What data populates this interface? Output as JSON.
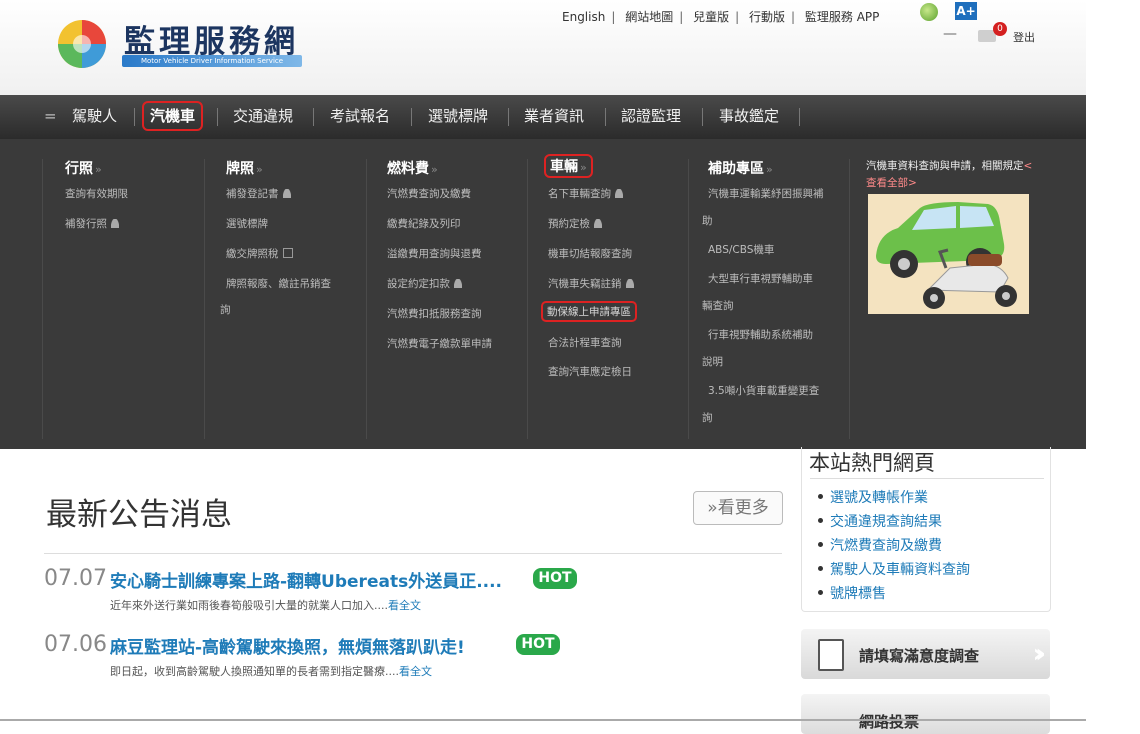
{
  "header": {
    "logo_title": "監理服務網",
    "logo_subtitle": "Motor Vehicle Driver Information Service",
    "top_links": [
      "English",
      "網站地圖",
      "兒童版",
      "行動版",
      "監理服務 APP"
    ],
    "accessible_label": "A+",
    "mail_count": "0",
    "logout": "登出"
  },
  "nav": {
    "items": [
      "駕駛人",
      "汽機車",
      "交通違規",
      "考試報名",
      "選號標牌",
      "業者資訊",
      "認證監理",
      "事故鑑定"
    ],
    "active": "汽機車"
  },
  "menu": {
    "col1": {
      "title": "行照",
      "items": [
        "查詢有效期限",
        "補發行照"
      ]
    },
    "col2": {
      "title": "牌照",
      "items": [
        "補發登記書",
        "選號標牌",
        "繳交牌照稅",
        "牌照報廢、繳註吊銷查",
        "詢"
      ]
    },
    "col3": {
      "title": "燃料費",
      "items": [
        "汽燃費查詢及繳費",
        "繳費紀錄及列印",
        "溢繳費用查詢與退費",
        "設定約定扣款",
        "汽燃費扣抵服務查詢",
        "汽燃費電子繳款單申請"
      ]
    },
    "col4": {
      "title": "車輛",
      "items": [
        "名下車輛查詢",
        "預約定檢",
        "機車切結報廢查詢",
        "汽機車失竊註銷",
        "動保線上申請專區",
        "合法計程車查詢",
        "查詢汽車應定檢日"
      ]
    },
    "col5": {
      "title": "補助專區",
      "items": [
        "汽機車運輸業紓困振興補",
        "助",
        "ABS/CBS機車",
        "大型車行車視野輔助車",
        "輛查詢",
        "行車視野輔助系統補助",
        "說明",
        "3.5噸小貨車載重變更查",
        "詢"
      ]
    },
    "promo": {
      "text": "汽機車資料查詢與申請，相關規定",
      "link": "<查看全部>"
    }
  },
  "news": {
    "title": "最新公告消息",
    "more": "»看更多",
    "items": [
      {
        "date": "07.07",
        "headline": "安心騎士訓練專案上路-翻轉Ubereats外送員正....",
        "badge": "HOT",
        "summary": "近年來外送行業如雨後春筍般吸引大量的就業人口加入....",
        "read_more": "看全文"
      },
      {
        "date": "07.06",
        "headline": "麻豆監理站-高齡駕駛來換照，無煩無落趴趴走!",
        "badge": "HOT",
        "summary": "即日起，收到高齡駕駛人換照通知單的長者需到指定醫療....",
        "read_more": "看全文"
      }
    ]
  },
  "side": {
    "title": "本站熱門網頁",
    "items": [
      "選號及轉帳作業",
      "交通違規查詢結果",
      "汽燃費查詢及繳費",
      "駕駛人及車輛資料查詢",
      "號牌標售"
    ],
    "survey": "請填寫滿意度調查",
    "survey2": "網路投票"
  },
  "colors": {
    "nav_bg": "#2b2b2b",
    "menu_bg": "#3a3a3a",
    "link_blue": "#1e7bb8",
    "hot_green": "#2aa84a",
    "highlight_red": "#dd2222"
  }
}
